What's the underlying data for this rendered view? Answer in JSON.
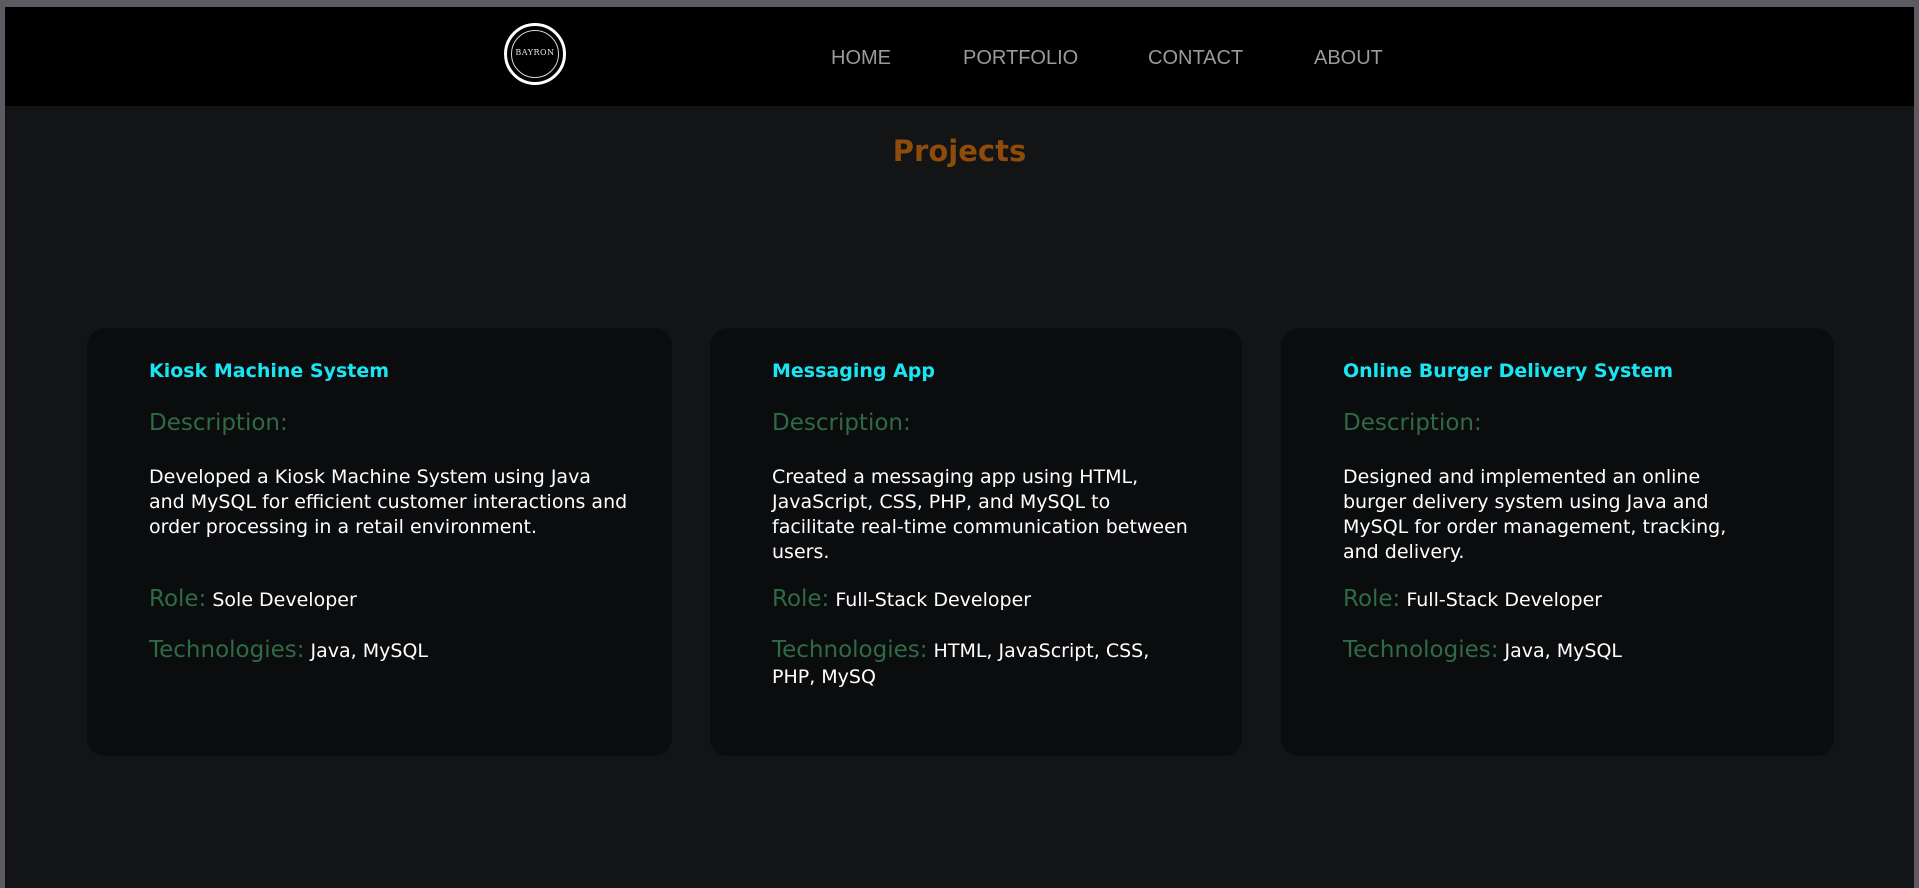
{
  "header": {
    "logo_text": "BAYRON",
    "nav": [
      {
        "label": "HOME"
      },
      {
        "label": "PORTFOLIO"
      },
      {
        "label": "CONTACT"
      },
      {
        "label": "ABOUT"
      }
    ]
  },
  "main": {
    "title": "Projects",
    "labels": {
      "description": "Description:",
      "role": "Role:",
      "technologies": "Technologies:"
    },
    "projects": [
      {
        "title": "Kiosk Machine System",
        "description": "Developed a Kiosk Machine System using Java and MySQL for efficient customer interactions and order processing in a retail environment.",
        "role": "Sole Developer",
        "technologies": "Java, MySQL"
      },
      {
        "title": "Messaging App",
        "description": "Created a messaging app using HTML, JavaScript, CSS, PHP, and MySQL to facilitate real-time communication between users.",
        "role": "Full-Stack Developer",
        "technologies": "HTML, JavaScript, CSS, PHP, MySQ"
      },
      {
        "title": "Online Burger Delivery System",
        "description": "Designed and implemented an online burger delivery system using Java and MySQL for order management, tracking, and delivery.",
        "role": "Full-Stack Developer",
        "technologies": "Java, MySQL"
      }
    ]
  },
  "colors": {
    "page_background": "#121416",
    "navbar_background": "#000000",
    "card_background": "#0b0c0e",
    "title_accent": "#8f4b09",
    "card_title": "#19e6f2",
    "label_green": "#2e6b45",
    "nav_text": "#9a9a9a"
  }
}
